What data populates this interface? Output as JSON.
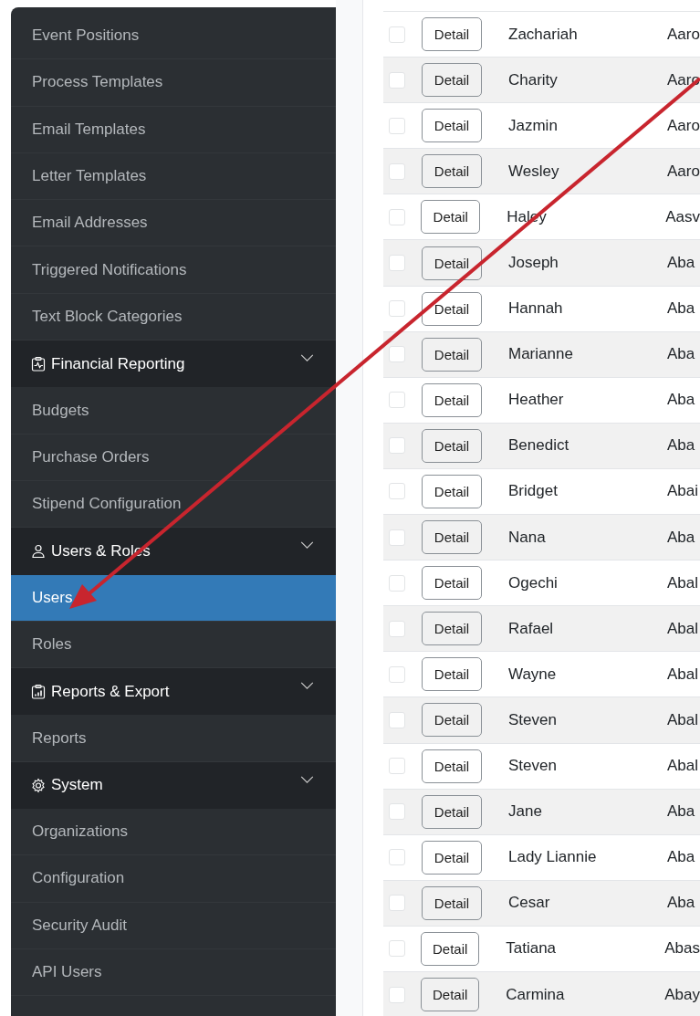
{
  "sidebar": {
    "items": [
      {
        "kind": "link",
        "label": "Event Positions",
        "selected": false
      },
      {
        "kind": "link",
        "label": "Process Templates",
        "selected": false
      },
      {
        "kind": "link",
        "label": "Email Templates",
        "selected": false
      },
      {
        "kind": "link",
        "label": "Letter Templates",
        "selected": false
      },
      {
        "kind": "link",
        "label": "Email Addresses",
        "selected": false
      },
      {
        "kind": "link",
        "label": "Triggered Notifications",
        "selected": false
      },
      {
        "kind": "link",
        "label": "Text Block Categories",
        "selected": false
      },
      {
        "kind": "section",
        "label": "Financial Reporting",
        "expanded": true
      },
      {
        "kind": "link",
        "label": "Budgets",
        "selected": false
      },
      {
        "kind": "link",
        "label": "Purchase Orders",
        "selected": false
      },
      {
        "kind": "link",
        "label": "Stipend Configuration",
        "selected": false
      },
      {
        "kind": "section",
        "label": "Users & Roles",
        "expanded": true
      },
      {
        "kind": "link",
        "label": "Users",
        "selected": true
      },
      {
        "kind": "link",
        "label": "Roles",
        "selected": false
      },
      {
        "kind": "section",
        "label": "Reports & Export",
        "expanded": true
      },
      {
        "kind": "link",
        "label": "Reports",
        "selected": false
      },
      {
        "kind": "section",
        "label": "System",
        "expanded": true
      },
      {
        "kind": "link",
        "label": "Organizations",
        "selected": false
      },
      {
        "kind": "link",
        "label": "Configuration",
        "selected": false
      },
      {
        "kind": "link",
        "label": "Security Audit",
        "selected": false
      },
      {
        "kind": "link",
        "label": "API Users",
        "selected": false
      }
    ]
  },
  "table": {
    "rows": [
      {
        "checked": false,
        "button": "Detail",
        "first_name": "Zachariah",
        "column_4": "Aaro"
      },
      {
        "checked": false,
        "button": "Detail",
        "first_name": "Charity",
        "column_4": "Aaro"
      },
      {
        "checked": false,
        "button": "Detail",
        "first_name": "Jazmin",
        "column_4": "Aaro"
      },
      {
        "checked": false,
        "button": "Detail",
        "first_name": "Wesley",
        "column_4": "Aaro"
      },
      {
        "checked": false,
        "button": "Detail",
        "first_name": "Haley",
        "column_4": "Aasv"
      },
      {
        "checked": false,
        "button": "Detail",
        "first_name": "Joseph",
        "column_4": "Aba"
      },
      {
        "checked": false,
        "button": "Detail",
        "first_name": "Hannah",
        "column_4": "Aba"
      },
      {
        "checked": false,
        "button": "Detail",
        "first_name": "Marianne",
        "column_4": "Aba"
      },
      {
        "checked": false,
        "button": "Detail",
        "first_name": "Heather",
        "column_4": "Aba"
      },
      {
        "checked": false,
        "button": "Detail",
        "first_name": "Benedict",
        "column_4": "Aba"
      },
      {
        "checked": false,
        "button": "Detail",
        "first_name": "Bridget",
        "column_4": "Abai"
      },
      {
        "checked": false,
        "button": "Detail",
        "first_name": "Nana",
        "column_4": "Aba"
      },
      {
        "checked": false,
        "button": "Detail",
        "first_name": "Ogechi",
        "column_4": "Abal"
      },
      {
        "checked": false,
        "button": "Detail",
        "first_name": "Rafael",
        "column_4": "Abal"
      },
      {
        "checked": false,
        "button": "Detail",
        "first_name": "Wayne",
        "column_4": "Abal"
      },
      {
        "checked": false,
        "button": "Detail",
        "first_name": "Steven",
        "column_4": "Abal"
      },
      {
        "checked": false,
        "button": "Detail",
        "first_name": "Steven",
        "column_4": "Abal"
      },
      {
        "checked": false,
        "button": "Detail",
        "first_name": "Jane",
        "column_4": "Aba"
      },
      {
        "checked": false,
        "button": "Detail",
        "first_name": "Lady Liannie",
        "column_4": "Aba"
      },
      {
        "checked": false,
        "button": "Detail",
        "first_name": "Cesar",
        "column_4": "Aba"
      },
      {
        "checked": false,
        "button": "Detail",
        "first_name": "Tatiana",
        "column_4": "Abas"
      },
      {
        "checked": false,
        "button": "Detail",
        "first_name": "Carmina",
        "column_4": "Abay"
      }
    ]
  }
}
